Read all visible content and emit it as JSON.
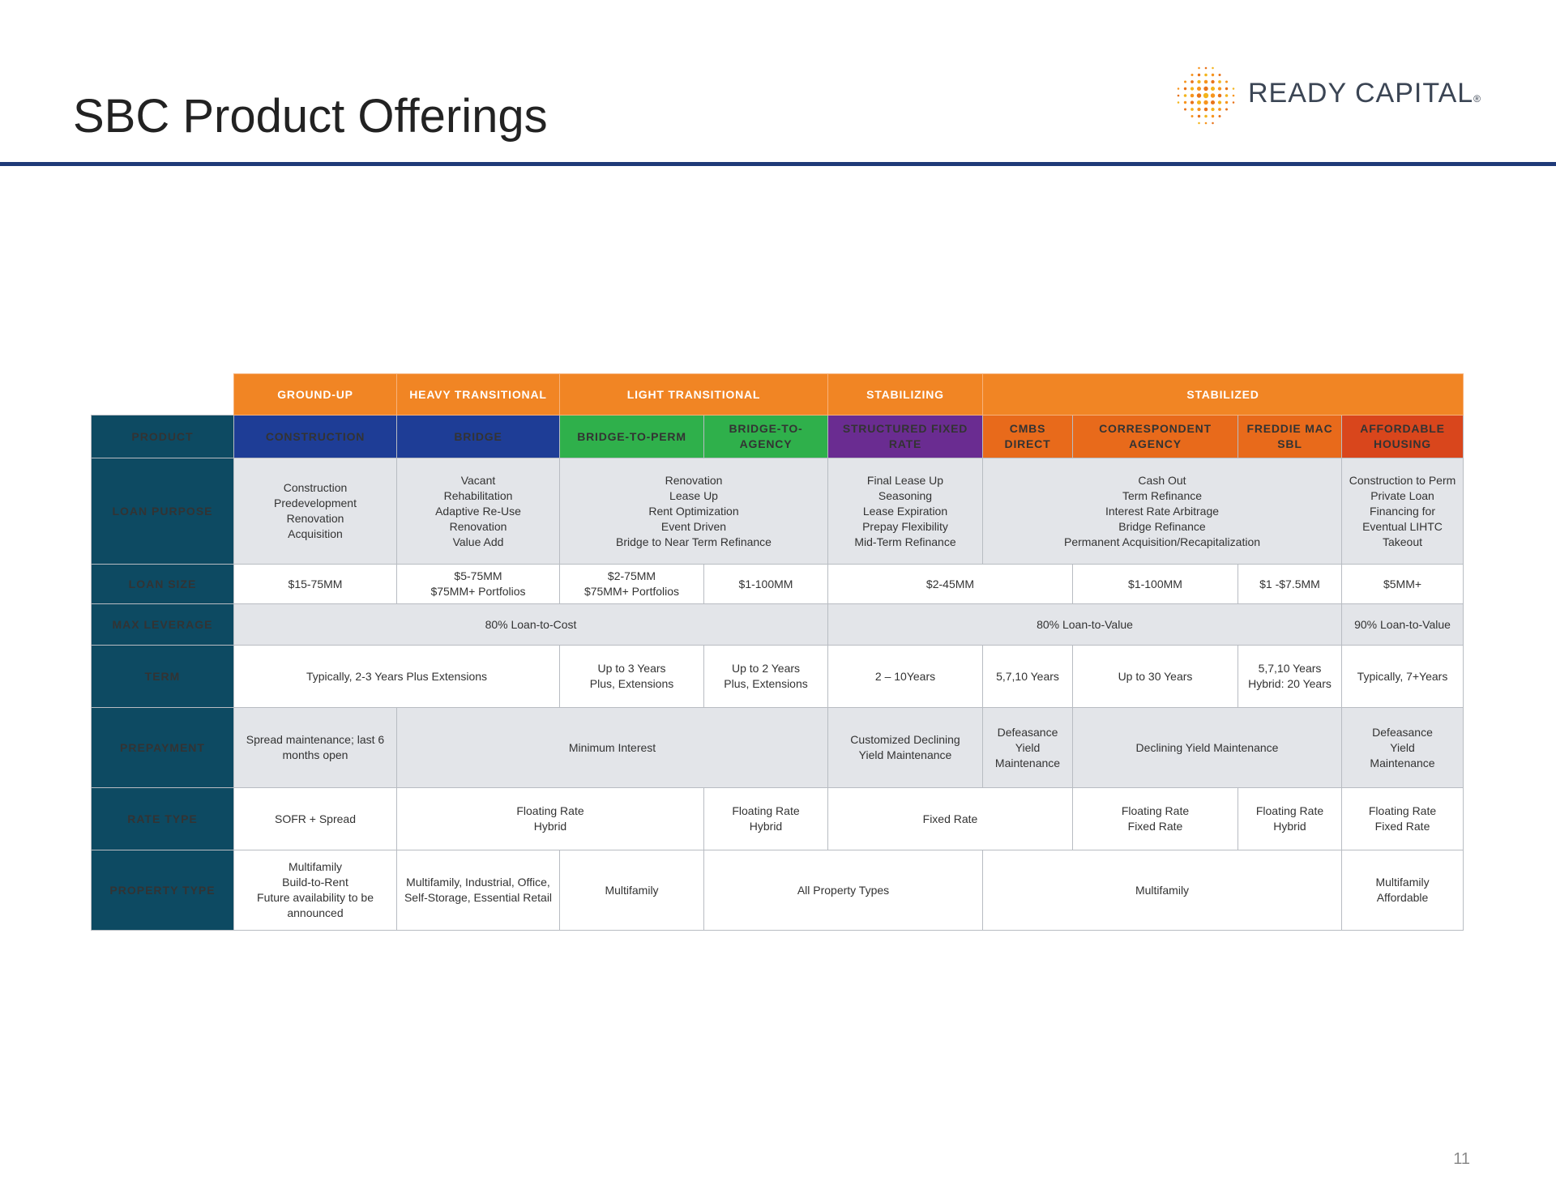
{
  "title": "SBC Product Offerings",
  "logo": {
    "text": "READY CAPITAL",
    "reg": "®",
    "dot_colors": [
      "#f7941d",
      "#e8731a",
      "#f3b51c"
    ]
  },
  "page_number": "11",
  "table": {
    "categories": [
      "GROUND-UP",
      "HEAVY TRANSITIONAL",
      "LIGHT TRANSITIONAL",
      "STABILIZING",
      "STABILIZED"
    ],
    "product_label": "PRODUCT",
    "products": [
      "CONSTRUCTION",
      "BRIDGE",
      "BRIDGE-TO-PERM",
      "BRIDGE-TO-\nAGENCY",
      "STRUCTURED FIXED\nRATE",
      "CMBS DIRECT",
      "CORRESPONDENT\nAGENCY",
      "FREDDIE MAC\nSBL",
      "AFFORDABLE\nHOUSING"
    ],
    "row_labels": {
      "loan_purpose": "LOAN PURPOSE",
      "loan_size": "LOAN SIZE",
      "max_leverage": "MAX LEVERAGE",
      "term": "TERM",
      "prepayment": "PREPAYMENT",
      "rate_type": "RATE TYPE",
      "property_type": "PROPERTY TYPE"
    },
    "loan_purpose": [
      "Construction\nPredevelopment\nRenovation\nAcquisition",
      "Vacant\nRehabilitation\nAdaptive Re-Use\nRenovation\nValue Add",
      "Renovation\nLease Up\nRent Optimization\nEvent Driven\nBridge to Near Term Refinance",
      "Final Lease Up\nSeasoning\nLease Expiration\nPrepay Flexibility\nMid-Term Refinance",
      "Cash Out\nTerm Refinance\nInterest Rate Arbitrage\nBridge Refinance\nPermanent Acquisition/Recapitalization",
      "Construction to Perm\nPrivate Loan\nFinancing for\nEventual LIHTC\nTakeout"
    ],
    "loan_size": [
      "$15-75MM",
      "$5-75MM\n$75MM+ Portfolios",
      "$2-75MM\n$75MM+ Portfolios",
      "$1-100MM",
      "$2-45MM",
      "$1-100MM",
      "$1 -$7.5MM",
      "$5MM+"
    ],
    "max_leverage": [
      "80% Loan-to-Cost",
      "80% Loan-to-Value",
      "90% Loan-to-Value"
    ],
    "term": [
      "Typically, 2-3 Years Plus Extensions",
      "Up to 3 Years\nPlus, Extensions",
      "Up to 2 Years\nPlus, Extensions",
      "2 – 10Years",
      "5,7,10 Years",
      "Up to 30 Years",
      "5,7,10 Years\nHybrid: 20 Years",
      "Typically, 7+Years"
    ],
    "prepayment": [
      "Spread maintenance; last 6\nmonths open",
      "Minimum Interest",
      "Customized Declining\nYield Maintenance",
      "Defeasance\nYield\nMaintenance",
      "Declining Yield Maintenance",
      "Defeasance\nYield\nMaintenance"
    ],
    "rate_type": [
      "SOFR + Spread",
      "Floating Rate\nHybrid",
      "Floating Rate\nHybrid",
      "Fixed Rate",
      "Floating Rate\nFixed Rate",
      "Floating Rate\nHybrid",
      "Floating Rate\nFixed Rate"
    ],
    "property_type": [
      "Multifamily\nBuild-to-Rent\nFuture availability to be\nannounced",
      "Multifamily, Industrial, Office,\nSelf-Storage, Essential Retail",
      "Multifamily",
      "All Property Types",
      "Multifamily",
      "Multifamily\nAffordable"
    ]
  }
}
